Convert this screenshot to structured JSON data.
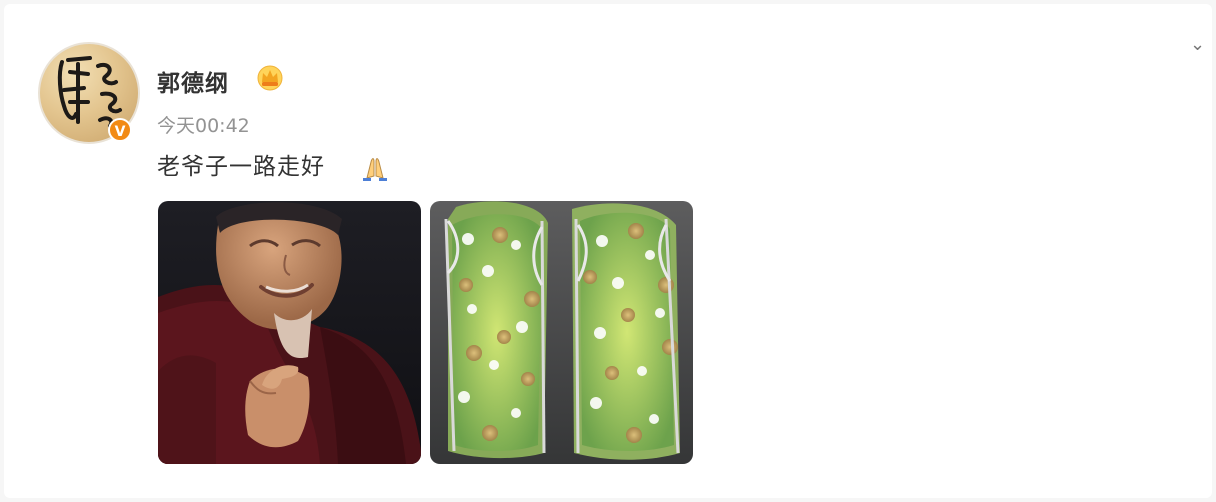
{
  "post": {
    "author": "郭德纲",
    "time": "今天00:42",
    "text": "老爷子一路走好",
    "verified_badge": "V",
    "icons": {
      "verified": "verified-badge-icon",
      "crown": "vip-crown-icon",
      "emoji": "praying-hands-icon",
      "menu": "chevron-down-icon"
    },
    "images": [
      {
        "name": "portrait-photo"
      },
      {
        "name": "wreath-photo"
      }
    ]
  }
}
